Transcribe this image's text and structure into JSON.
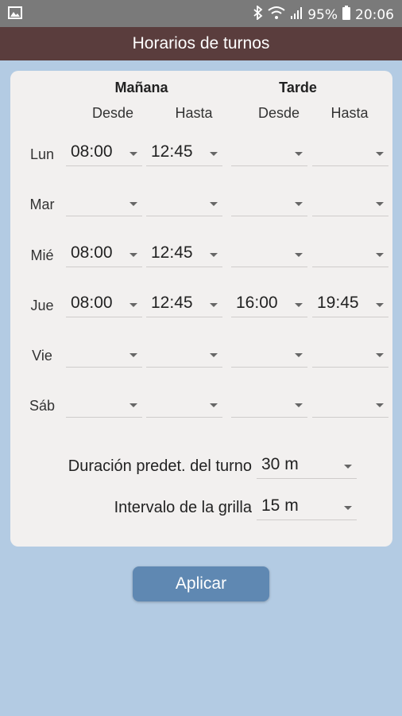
{
  "status": {
    "battery": "95%",
    "time": "20:06"
  },
  "appbar": {
    "title": "Horarios de turnos"
  },
  "headers": {
    "morning": "Mañana",
    "afternoon": "Tarde",
    "from1": "Desde",
    "to1": "Hasta",
    "from2": "Desde",
    "to2": "Hasta"
  },
  "rows": [
    {
      "day": "Lun",
      "m_from": "08:00",
      "m_to": "12:45",
      "a_from": "",
      "a_to": ""
    },
    {
      "day": "Mar",
      "m_from": "",
      "m_to": "",
      "a_from": "",
      "a_to": ""
    },
    {
      "day": "Mié",
      "m_from": "08:00",
      "m_to": "12:45",
      "a_from": "",
      "a_to": ""
    },
    {
      "day": "Jue",
      "m_from": "08:00",
      "m_to": "12:45",
      "a_from": "16:00",
      "a_to": "19:45"
    },
    {
      "day": "Vie",
      "m_from": "",
      "m_to": "",
      "a_from": "",
      "a_to": ""
    },
    {
      "day": "Sáb",
      "m_from": "",
      "m_to": "",
      "a_from": "",
      "a_to": ""
    }
  ],
  "settings": {
    "duration_label": "Duración predet. del turno",
    "duration_value": "30 m",
    "interval_label": "Intervalo de la grilla",
    "interval_value": "15 m"
  },
  "apply_label": "Aplicar"
}
